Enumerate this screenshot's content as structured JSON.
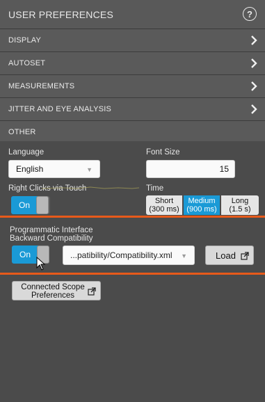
{
  "header": {
    "title": "USER PREFERENCES",
    "help_glyph": "?"
  },
  "sections": [
    {
      "label": "DISPLAY",
      "expanded": false
    },
    {
      "label": "AUTOSET",
      "expanded": false
    },
    {
      "label": "MEASUREMENTS",
      "expanded": false
    },
    {
      "label": "JITTER AND EYE ANALYSIS",
      "expanded": false
    },
    {
      "label": "OTHER",
      "expanded": true
    }
  ],
  "other": {
    "language": {
      "label": "Language",
      "value": "English"
    },
    "font_size": {
      "label": "Font Size",
      "value": "15"
    },
    "right_clicks": {
      "label": "Right Clicks via Touch",
      "state": "On"
    },
    "time": {
      "label": "Time",
      "options": [
        {
          "line1": "Short",
          "line2": "(300 ms)"
        },
        {
          "line1": "Medium",
          "line2": "(900 ms)"
        },
        {
          "line1": "Long",
          "line2": "(1.5 s)"
        }
      ],
      "selected": "Medium"
    },
    "programmatic": {
      "label_line1": "Programmatic Interface",
      "label_line2": "Backward Compatibility",
      "state": "On",
      "file": "...patibility/Compatibility.xml",
      "load_label": "Load"
    },
    "connected_scope": {
      "line1": "Connected Scope",
      "line2": "Preferences"
    }
  },
  "colors": {
    "accent": "#1a9ad6",
    "highlight_line": "#e85a1a",
    "panel_bg": "#4b4b4b"
  }
}
